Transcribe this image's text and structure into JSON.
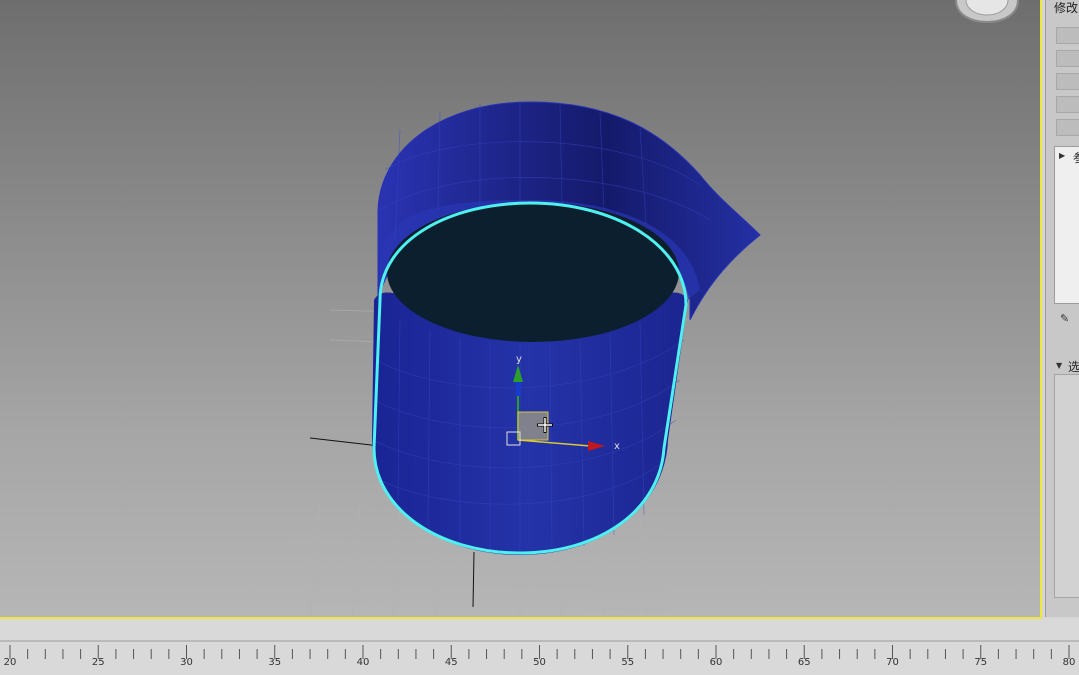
{
  "panel": {
    "title": "修改",
    "rollout_label": "参",
    "selection_label": "选"
  },
  "viewport": {
    "gizmo": {
      "x_label": "x",
      "y_label": "y"
    },
    "object_color": "#1f2ba0",
    "selection_color": "#4ff0f0",
    "active_border_color": "#f0e63a"
  },
  "timeline": {
    "ticks": [
      "20",
      "25",
      "30",
      "35",
      "40",
      "45",
      "50",
      "55",
      "60",
      "65",
      "70",
      "75",
      "80"
    ]
  }
}
